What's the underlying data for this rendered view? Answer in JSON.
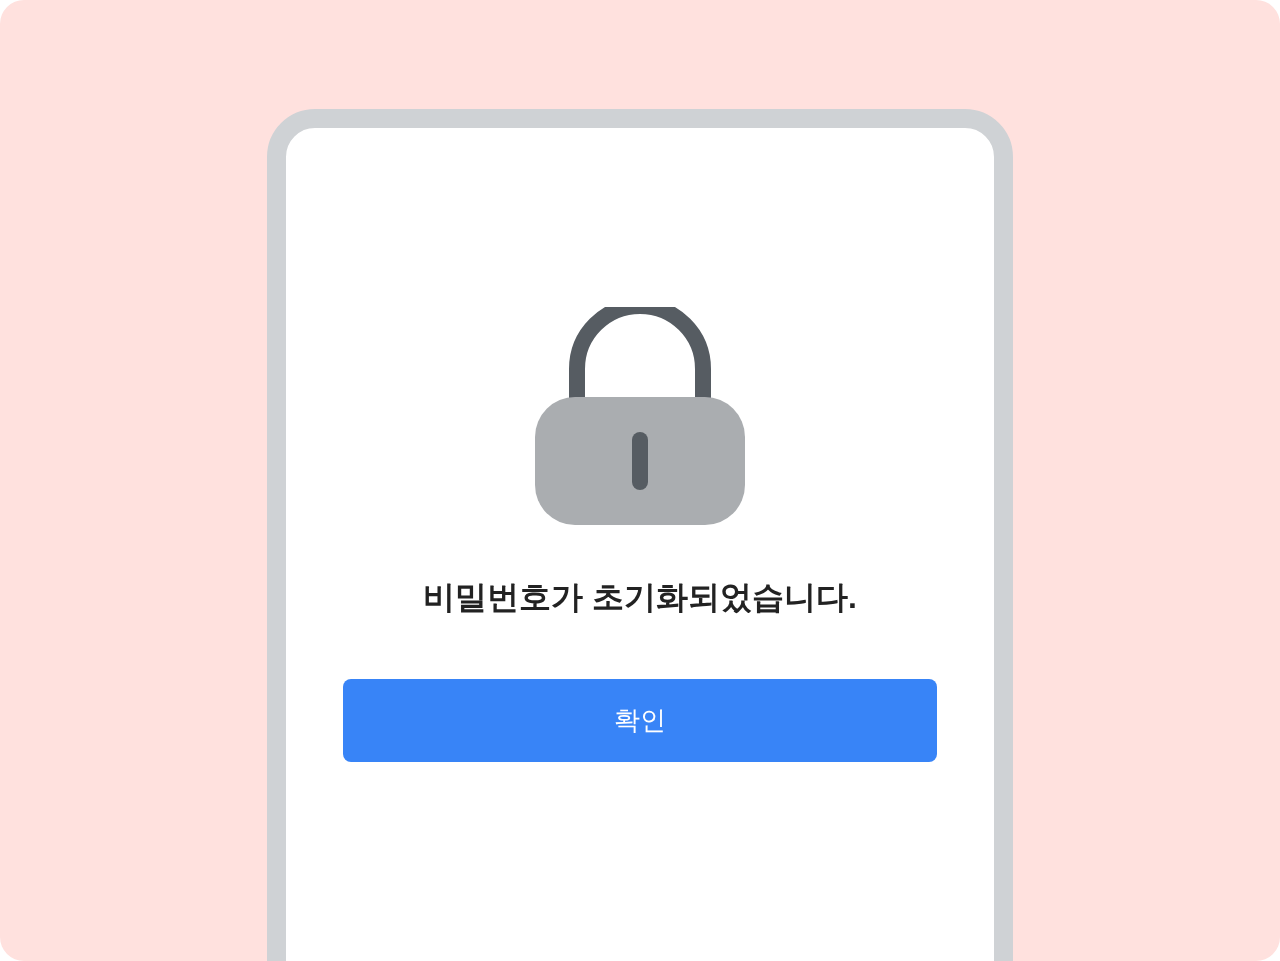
{
  "screen": {
    "message": "비밀번호가 초기화되었습니다.",
    "button": {
      "label": "확인"
    }
  }
}
